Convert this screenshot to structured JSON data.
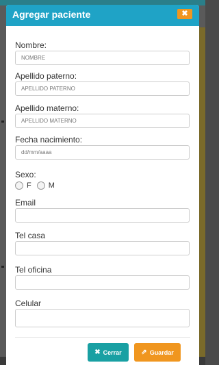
{
  "modal": {
    "title": "Agregar paciente",
    "close_icon": "times-icon"
  },
  "fields": {
    "nombre": {
      "label": "Nombre:",
      "placeholder": "NOMBRE"
    },
    "apellido_paterno": {
      "label": "Apellido paterno:",
      "placeholder": "APELLIDO PATERNO"
    },
    "apellido_materno": {
      "label": "Apellido materno:",
      "placeholder": "APELLIDO MATERNO"
    },
    "fecha_nacimiento": {
      "label": "Fecha nacimiento:",
      "placeholder": "dd/mm/aaaa"
    },
    "sexo": {
      "label": "Sexo:",
      "options": [
        "F",
        "M"
      ]
    },
    "email": {
      "label": "Email"
    },
    "tel_casa": {
      "label": "Tel casa"
    },
    "tel_oficina": {
      "label": "Tel oficina"
    },
    "celular": {
      "label": "Celular"
    }
  },
  "buttons": {
    "cerrar": {
      "label": "Cerrar",
      "icon": "times-icon",
      "color": "#19a0a3"
    },
    "guardar": {
      "label": "Guardar",
      "icon": "share-square-icon",
      "color": "#f0961f"
    }
  },
  "colors": {
    "header": "#1fa3c6",
    "accent": "#f0961f"
  }
}
